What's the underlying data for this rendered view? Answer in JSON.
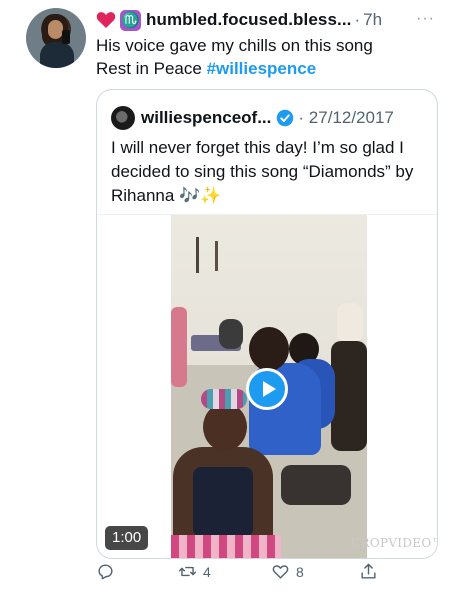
{
  "tweet": {
    "username": "humbled.focused.bless...",
    "separator": "·",
    "time": "7h",
    "more": "···",
    "zodiac_glyph": "♏",
    "text_line1": "His voice gave my chills on this song",
    "text_line2_prefix": "Rest in Peace ",
    "hashtag": "#williespence"
  },
  "quote": {
    "username": "williespenceof...",
    "separator": "·",
    "date": "27/12/2017",
    "text": "I will never forget this day! I’m so glad I decided to sing this song “Diamonds” by Rihanna 🎶✨"
  },
  "video": {
    "duration": "1:00",
    "watermark": "CROPVIDEO™"
  },
  "actions": {
    "retweets": "4",
    "likes": "8"
  },
  "colors": {
    "accent": "#1d9bf0",
    "heart": "#e0245e",
    "zodiac_bg": "#a654c9",
    "muted": "#536471"
  },
  "icons": [
    "heart-emoji-icon",
    "scorpio-icon",
    "more-icon",
    "verified-icon",
    "play-icon",
    "reply-icon",
    "retweet-icon",
    "like-icon",
    "share-icon"
  ]
}
